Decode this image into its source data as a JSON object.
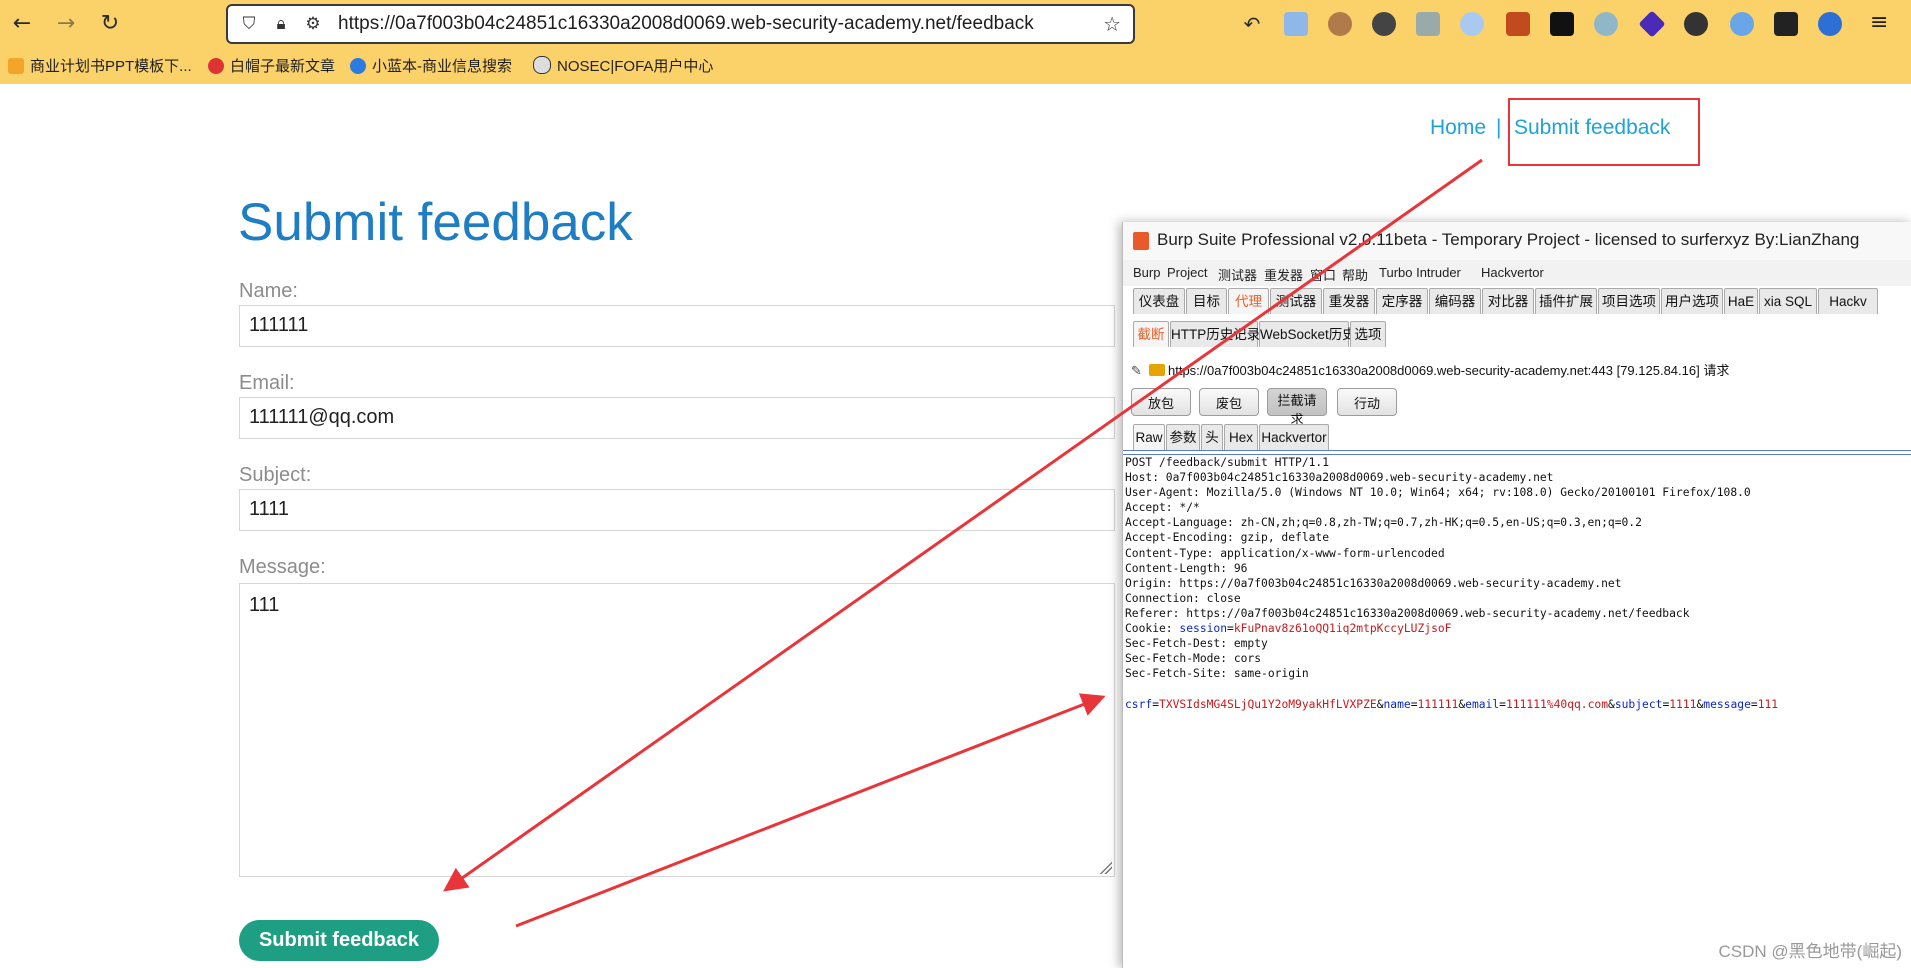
{
  "browser": {
    "url": "https://0a7f003b04c24851c16330a2008d0069.web-security-academy.net/feedback",
    "bookmarks": [
      "商业计划书PPT模板下...",
      "白帽子最新文章",
      "小蓝本-商业信息搜索",
      "NOSEC|FOFA用户中心"
    ]
  },
  "page": {
    "nav": {
      "home": "Home",
      "separator": "|",
      "submit_feedback": "Submit feedback"
    },
    "title": "Submit feedback",
    "form": {
      "name_label": "Name:",
      "name_value": "111111",
      "email_label": "Email:",
      "email_value": "111111@qq.com",
      "subject_label": "Subject:",
      "subject_value": "1111",
      "message_label": "Message:",
      "message_value": "111",
      "submit_label": "Submit feedback"
    }
  },
  "burp": {
    "title": "Burp Suite Professional v2.0.11beta - Temporary Project - licensed to surferxyz By:LianZhang",
    "menu": [
      "Burp",
      "Project",
      "测试器",
      "重发器",
      "窗口",
      "帮助",
      "Turbo Intruder",
      "Hackvertor"
    ],
    "tabs": [
      "仪表盘",
      "目标",
      "代理",
      "测试器",
      "重发器",
      "定序器",
      "编码器",
      "对比器",
      "插件扩展",
      "项目选项",
      "用户选项",
      "HaE",
      "xia SQL",
      "Hackv"
    ],
    "active_tab": "代理",
    "sub_tabs": [
      "截断",
      "HTTP历史记录",
      "WebSocket历史",
      "选项"
    ],
    "active_sub_tab": "截断",
    "target": "https://0a7f003b04c24851c16330a2008d0069.web-security-academy.net:443  [79.125.84.16] 请求",
    "buttons": [
      "放包",
      "废包",
      "拦截请求",
      "行动"
    ],
    "view_tabs": [
      "Raw",
      "参数",
      "头",
      "Hex",
      "Hackvertor"
    ],
    "request_lines": [
      "POST /feedback/submit HTTP/1.1",
      "Host: 0a7f003b04c24851c16330a2008d0069.web-security-academy.net",
      "User-Agent: Mozilla/5.0 (Windows NT 10.0; Win64; x64; rv:108.0) Gecko/20100101 Firefox/108.0",
      "Accept: */*",
      "Accept-Language: zh-CN,zh;q=0.8,zh-TW;q=0.7,zh-HK;q=0.5,en-US;q=0.3,en;q=0.2",
      "Accept-Encoding: gzip, deflate",
      "Content-Type: application/x-www-form-urlencoded",
      "Content-Length: 96",
      "Origin: https://0a7f003b04c24851c16330a2008d0069.web-security-academy.net",
      "Connection: close",
      "Referer: https://0a7f003b04c24851c16330a2008d0069.web-security-academy.net/feedback"
    ],
    "cookie": {
      "prefix": "Cookie: ",
      "name": "session",
      "value": "kFuPnav8z61oQQ1iq2mtpKccyLUZjsoF"
    },
    "request_lines_after": [
      "Sec-Fetch-Dest: empty",
      "Sec-Fetch-Mode: cors",
      "Sec-Fetch-Site: same-origin"
    ],
    "body_params": [
      {
        "k": "csrf",
        "v": "TXVSIdsMG4SLjQu1Y2oM9yakHfLVXPZE"
      },
      {
        "k": "name",
        "v": "111111"
      },
      {
        "k": "email",
        "v": "111111%40qq.com"
      },
      {
        "k": "subject",
        "v": "1111"
      },
      {
        "k": "message",
        "v": "111"
      }
    ]
  },
  "watermark": "CSDN @黑色地带(崛起)",
  "colors": {
    "chrome": "#fbd26a",
    "link": "#1ea3d8",
    "title": "#1e7dc3",
    "button": "#1e9f84",
    "annotation": "#e8353a"
  }
}
